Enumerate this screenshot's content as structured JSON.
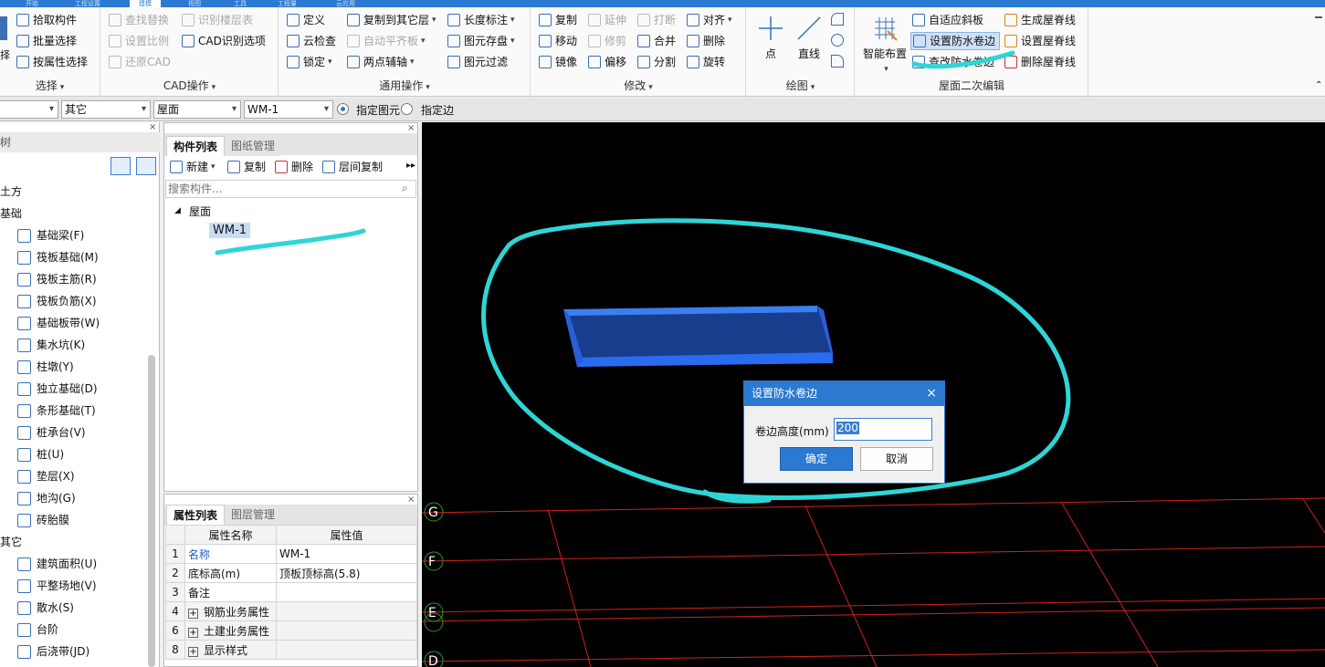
{
  "tabs": [
    "开始",
    "工程设置",
    "建模",
    "视图",
    "工具",
    "工程量",
    "云应用"
  ],
  "ribbon": {
    "select_group": {
      "title": "选择",
      "items": [
        "拾取构件",
        "批量选择",
        "按属性选择"
      ]
    },
    "cad_group": {
      "title": "CAD操作",
      "items": [
        "查找替换",
        "识别楼层表",
        "设置比例",
        "CAD识别选项",
        "还原CAD"
      ]
    },
    "general_group": {
      "title": "通用操作",
      "items": [
        "定义",
        "复制到其它层",
        "长度标注",
        "云检查",
        "自动平齐板",
        "图元存盘",
        "锁定",
        "两点辅轴",
        "图元过滤"
      ]
    },
    "modify_group": {
      "title": "修改",
      "items": [
        "复制",
        "延伸",
        "打断",
        "对齐",
        "移动",
        "修剪",
        "合并",
        "删除",
        "镜像",
        "偏移",
        "分割",
        "旋转"
      ]
    },
    "draw_group": {
      "title": "绘图",
      "items": [
        "点",
        "直线"
      ]
    },
    "roof_group": {
      "title": "屋面二次编辑",
      "items": [
        "智能布置",
        "自适应斜板",
        "生成屋脊线",
        "设置防水卷边",
        "设置屋脊线",
        "查改防水卷边",
        "删除屋脊线"
      ]
    }
  },
  "optbar": {
    "selects": [
      "",
      "其它",
      "屋面",
      "WM-1"
    ],
    "radio1": "指定图元",
    "radio2": "指定边"
  },
  "left_tree": {
    "header": "树",
    "cat1": "土方",
    "cat2": "基础",
    "items_foundation": [
      "基础梁(F)",
      "筏板基础(M)",
      "筏板主筋(R)",
      "筏板负筋(X)",
      "基础板带(W)",
      "集水坑(K)",
      "柱墩(Y)",
      "独立基础(D)",
      "条形基础(T)",
      "桩承台(V)",
      "桩(U)",
      "垫层(X)",
      "地沟(G)",
      "砖胎膜"
    ],
    "cat3": "其它",
    "items_other": [
      "建筑面积(U)",
      "平整场地(V)",
      "散水(S)",
      "台阶",
      "后浇带(JD)"
    ]
  },
  "component_panel": {
    "tab_active": "构件列表",
    "tab_other": "图纸管理",
    "toolbar": [
      "新建",
      "复制",
      "删除",
      "层间复制"
    ],
    "search_placeholder": "搜索构件...",
    "tree_root": "屋面",
    "tree_child": "WM-1"
  },
  "property_panel": {
    "tab_active": "属性列表",
    "tab_other": "图层管理",
    "col_name": "属性名称",
    "col_value": "属性值",
    "rows": [
      {
        "num": "1",
        "name": "名称",
        "value": "WM-1"
      },
      {
        "num": "2",
        "name": "底标高(m)",
        "value": "顶板顶标高(5.8)"
      },
      {
        "num": "3",
        "name": "备注",
        "value": ""
      },
      {
        "num": "4",
        "name": "钢筋业务属性",
        "value": ""
      },
      {
        "num": "6",
        "name": "土建业务属性",
        "value": ""
      },
      {
        "num": "8",
        "name": "显示样式",
        "value": ""
      }
    ]
  },
  "axis_labels": [
    "G",
    "F",
    "E",
    "D"
  ],
  "dialog": {
    "title": "设置防水卷边",
    "label": "卷边高度(mm)",
    "value": "200",
    "ok": "确定",
    "cancel": "取消"
  },
  "colors": {
    "accent": "#2b79d0",
    "annotation": "#2fd5d5",
    "slab": "#1f5fd8",
    "grid": "#d42020"
  }
}
